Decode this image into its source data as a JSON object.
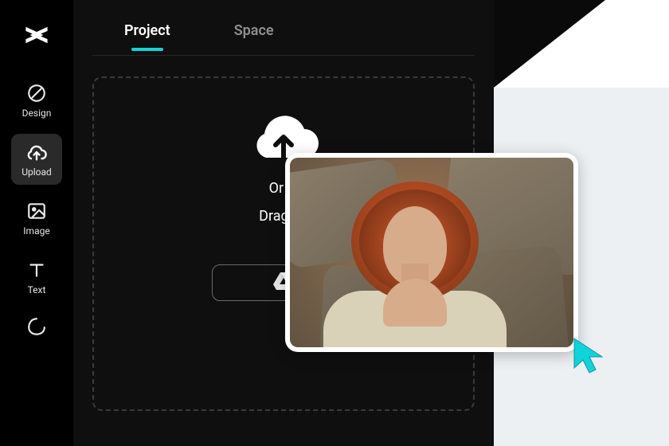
{
  "sidebar": {
    "logo_name": "capcut-logo",
    "items": [
      {
        "label": "Design",
        "icon": "brush-icon"
      },
      {
        "label": "Upload",
        "icon": "cloud-upload-icon",
        "active": true
      },
      {
        "label": "Image",
        "icon": "image-icon"
      },
      {
        "label": "Text",
        "icon": "text-icon"
      },
      {
        "label": "",
        "icon": "shape-icon"
      }
    ]
  },
  "tabs": [
    {
      "label": "Project",
      "active": true
    },
    {
      "label": "Space",
      "active": false
    }
  ],
  "dropzone": {
    "line1": "Or cl",
    "line2": "Drag an",
    "cloud_icon": "cloud-upload-large-icon",
    "drive_button_icon": "google-drive-icon"
  },
  "photo": {
    "alt": "portrait-photo-thumbnail"
  },
  "cursor_icon": "pointer-cursor-icon",
  "colors": {
    "accent": "#11d3d9"
  }
}
